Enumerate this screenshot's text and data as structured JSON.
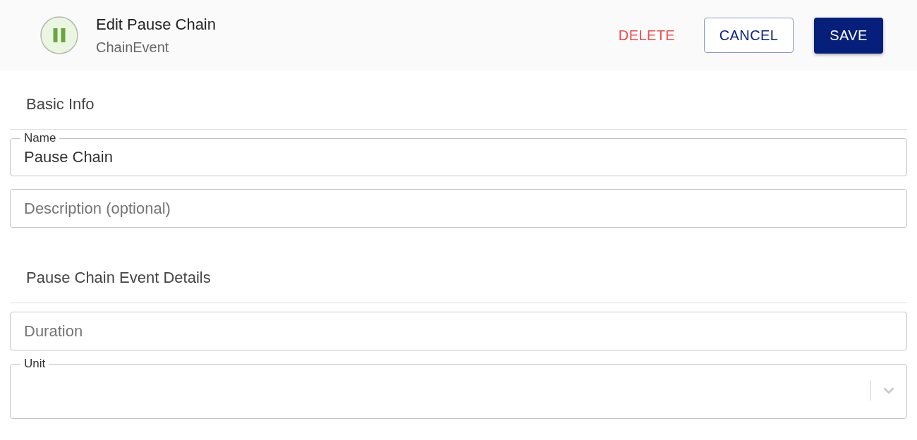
{
  "header": {
    "title": "Edit Pause Chain",
    "subtitle": "ChainEvent",
    "buttons": [
      {
        "kind": "danger",
        "label": "DELETE"
      },
      {
        "kind": "outlined",
        "label": "CANCEL"
      },
      {
        "kind": "primary",
        "label": "SAVE"
      }
    ]
  },
  "sections": [
    {
      "title": "Basic Info",
      "fields": [
        {
          "kind": "text",
          "label": "Name",
          "value": "Pause Chain"
        },
        {
          "kind": "text",
          "placeholder": "Description (optional)"
        }
      ]
    },
    {
      "title": "Pause Chain Event Details",
      "fields": [
        {
          "kind": "text",
          "placeholder": "Duration"
        },
        {
          "kind": "select",
          "label": "Unit"
        }
      ]
    }
  ]
}
